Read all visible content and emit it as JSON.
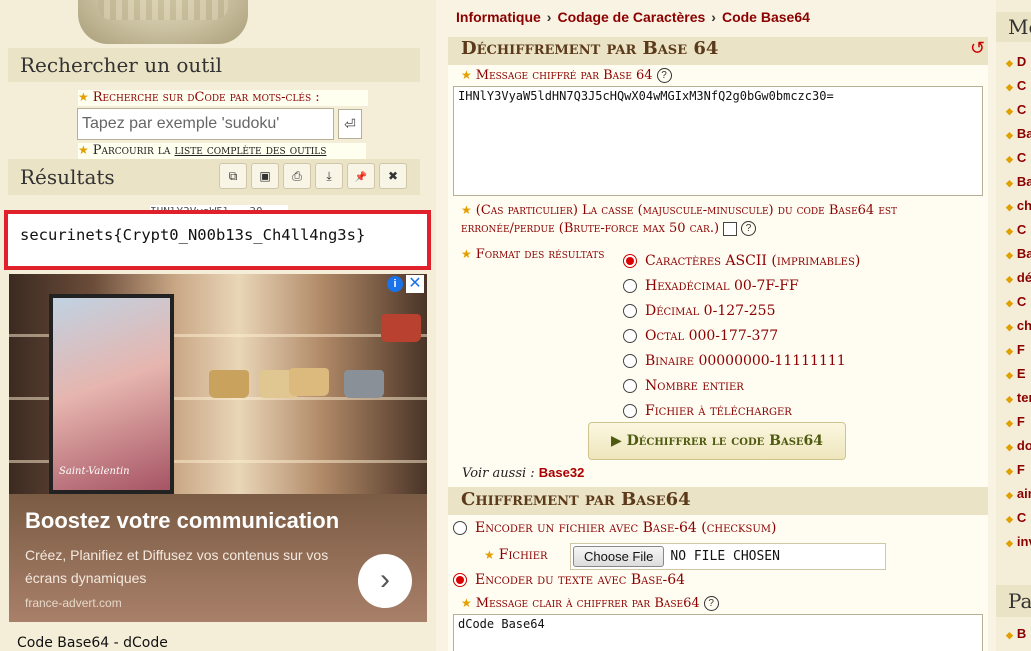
{
  "left": {
    "search_title": "Rechercher un outil",
    "keyword_label": "Recherche sur dCode par mots-clés :",
    "search_placeholder": "Tapez par exemple 'sudoku'",
    "search_go": "⏎",
    "browse_prefix": "Parcourir la ",
    "browse_link": "liste complète des outils",
    "results_title": "Résultats",
    "tools": [
      {
        "icon": "copy-icon",
        "glyph": "⧉"
      },
      {
        "icon": "screenshot-icon",
        "glyph": "▣"
      },
      {
        "icon": "print-icon",
        "glyph": "⎙"
      },
      {
        "icon": "download-icon",
        "glyph": "⤓"
      },
      {
        "icon": "pin-icon",
        "glyph": "📌"
      },
      {
        "icon": "close-icon",
        "glyph": "✖"
      }
    ],
    "cipher_echo": "IHNlY3VyaW5l...30",
    "result": "securinets{Crypt0_N00b13s_Ch4ll4ng3s}",
    "page_name": "Code Base64 - dCode"
  },
  "ad": {
    "headline": "Boostez votre communication",
    "body": "Créez, Planifiez et Diffusez vos contenus sur vos écrans dynamiques",
    "url": "france-advert.com",
    "screen_caption": "Saint-Valentin",
    "info": "i",
    "close": "✕",
    "arrow": "›"
  },
  "breadcrumb": [
    "Informatique",
    "Codage de Caractères",
    "Code Base64"
  ],
  "decrypt": {
    "title": "Déchiffrement par Base 64",
    "refresh": "↺",
    "msg_label": "Message chiffré par Base 64",
    "msg_value": "IHNlY3VyaW5ldHN7Q3J5cHQwX04wMGIxM3NfQ2g0bGw0bmczc30=",
    "case_label": "(Cas particulier) La casse (majuscule-minuscule) du code Base64 est erronée/perdue (Brute-force max 50 car.)",
    "format_label": "Format des résultats",
    "formats": [
      {
        "label": "Caractères ASCII (imprimables)",
        "selected": true
      },
      {
        "label": "Hexadécimal 00-7F-FF",
        "selected": false
      },
      {
        "label": "Décimal 0-127-255",
        "selected": false
      },
      {
        "label": "Octal 000-177-377",
        "selected": false
      },
      {
        "label": "Binaire 00000000-11111111",
        "selected": false
      },
      {
        "label": "Nombre entier",
        "selected": false
      },
      {
        "label": "Fichier à télécharger",
        "selected": false
      }
    ],
    "button": "▶ Déchiffrer le code Base64",
    "see_also": "Voir aussi : ",
    "see_also_link": "Base32"
  },
  "encrypt": {
    "title": "Chiffrement par Base64",
    "opt_file": "Encoder un fichier avec Base-64 (checksum)",
    "file_label": "Fichier",
    "choose_file": "Choose File",
    "no_file": "NO FILE CHOSEN",
    "opt_text": "Encoder du texte avec Base-64",
    "msg_label": "Message clair à chiffrer par Base64",
    "msg_value": "dCode Base64"
  },
  "right": {
    "title": "Me",
    "items": [
      "D",
      "C",
      "C",
      "Bas",
      "C",
      "Bas",
      "chif",
      "C",
      "Bas",
      "déc",
      "C",
      "chif",
      "F",
      "E",
      "tern",
      "F",
      "don",
      "F",
      "ains",
      "C",
      "inve"
    ],
    "title2": "Pa",
    "last_item": "B"
  },
  "colors": {
    "accent": "#8b0000",
    "highlight": "#e0202a",
    "panel": "#ebe3c5"
  }
}
